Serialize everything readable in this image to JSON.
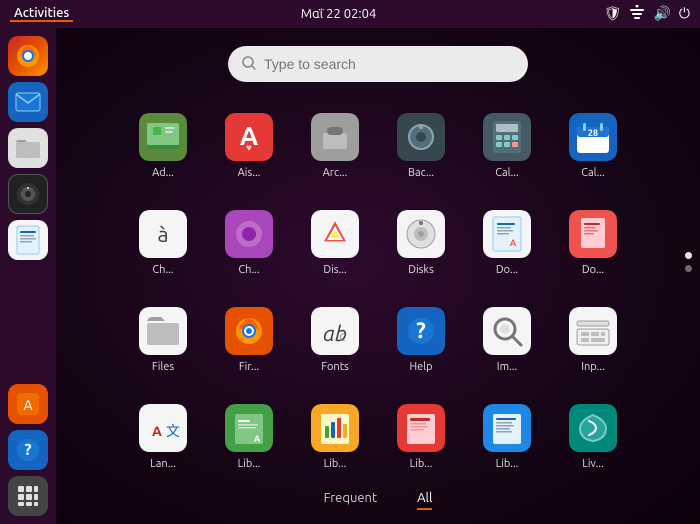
{
  "topbar": {
    "activities_label": "Activities",
    "datetime": "Μαΐ 22  02:04",
    "icons": [
      "shield",
      "network",
      "volume",
      "power"
    ]
  },
  "search": {
    "placeholder": "Type to search"
  },
  "tabs": [
    {
      "id": "frequent",
      "label": "Frequent",
      "active": false
    },
    {
      "id": "all",
      "label": "All",
      "active": true
    }
  ],
  "apps": [
    {
      "id": "ad",
      "label": "Ad...",
      "icon": "🖥️",
      "bg": "#5c8a3c"
    },
    {
      "id": "ais",
      "label": "Ais...",
      "icon": "🃏",
      "bg": "#e53935"
    },
    {
      "id": "arc",
      "label": "Arc...",
      "icon": "📦",
      "bg": "#9e9e9e"
    },
    {
      "id": "bac",
      "label": "Bac...",
      "icon": "💾",
      "bg": "#37474f"
    },
    {
      "id": "calc",
      "label": "Cal...",
      "icon": "🔢",
      "bg": "#455a64"
    },
    {
      "id": "calendar",
      "label": "Cal...",
      "icon": "📅",
      "bg": "#1565c0"
    },
    {
      "id": "ch1",
      "label": "Ch...",
      "icon": "à",
      "bg": "#f5f5f5"
    },
    {
      "id": "ch2",
      "label": "Ch...",
      "icon": "🔮",
      "bg": "#ab47bc"
    },
    {
      "id": "dis",
      "label": "Dis...",
      "icon": "🥧",
      "bg": "#f5f5f5"
    },
    {
      "id": "disks",
      "label": "Disks",
      "icon": "💿",
      "bg": "#f5f5f5"
    },
    {
      "id": "doc1",
      "label": "Do...",
      "icon": "📄",
      "bg": "#f5f5f5"
    },
    {
      "id": "doc2",
      "label": "Do...",
      "icon": "📖",
      "bg": "#ef5350"
    },
    {
      "id": "files",
      "label": "Files",
      "icon": "📁",
      "bg": "#f5f5f5"
    },
    {
      "id": "firefox",
      "label": "Fir...",
      "icon": "🦊",
      "bg": "#e65100"
    },
    {
      "id": "fonts",
      "label": "Fonts",
      "icon": "🔤",
      "bg": "#f5f5f5"
    },
    {
      "id": "help",
      "label": "Help",
      "icon": "❓",
      "bg": "#1565c0"
    },
    {
      "id": "im",
      "label": "Im...",
      "icon": "🔍",
      "bg": "#f5f5f5"
    },
    {
      "id": "inp",
      "label": "Inp...",
      "icon": "⌨️",
      "bg": "#f5f5f5"
    },
    {
      "id": "lan",
      "label": "Lan...",
      "icon": "🌐",
      "bg": "#f5f5f5"
    },
    {
      "id": "lib1",
      "label": "Lib...",
      "icon": "📗",
      "bg": "#43a047"
    },
    {
      "id": "lib2",
      "label": "Lib...",
      "icon": "📊",
      "bg": "#f9a825"
    },
    {
      "id": "lib3",
      "label": "Lib...",
      "icon": "📰",
      "bg": "#e53935"
    },
    {
      "id": "lib4",
      "label": "Lib...",
      "icon": "📝",
      "bg": "#1e88e5"
    },
    {
      "id": "liv",
      "label": "Liv...",
      "icon": "🔄",
      "bg": "#00897b"
    }
  ],
  "sidebar": {
    "apps": [
      {
        "id": "firefox",
        "icon": "🦊"
      },
      {
        "id": "mail",
        "icon": "✉️"
      },
      {
        "id": "files",
        "icon": "📁"
      },
      {
        "id": "rhythmbox",
        "icon": "🎵"
      },
      {
        "id": "writer",
        "icon": "📝"
      },
      {
        "id": "appstore",
        "icon": "🏪"
      },
      {
        "id": "help",
        "icon": "❓"
      }
    ],
    "grid_icon": "⊞"
  },
  "pagination": {
    "dots": [
      {
        "active": true
      },
      {
        "active": false
      }
    ]
  }
}
